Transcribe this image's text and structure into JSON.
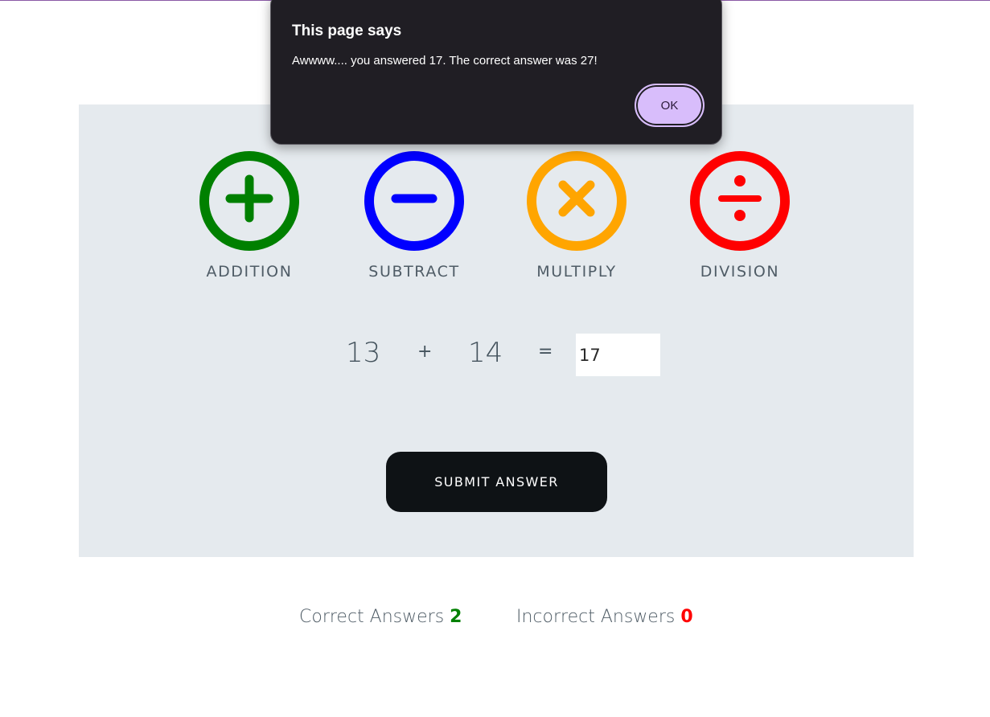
{
  "game": {
    "operations": [
      {
        "label": "ADDITION",
        "icon": "plus-circle-icon",
        "color": "#008000"
      },
      {
        "label": "SUBTRACT",
        "icon": "minus-circle-icon",
        "color": "#0000ff"
      },
      {
        "label": "MULTIPLY",
        "icon": "times-circle-icon",
        "color": "#ffa500"
      },
      {
        "label": "DIVISION",
        "icon": "divide-circle-icon",
        "color": "#ff0000"
      }
    ],
    "question": {
      "operand1": "13",
      "operator": "+",
      "operand2": "14",
      "equals": "=",
      "answer_value": "17"
    },
    "submit_label": "SUBMIT ANSWER"
  },
  "score": {
    "correct_label": "Correct Answers",
    "correct_value": "2",
    "correct_color": "#008000",
    "incorrect_label": "Incorrect Answers",
    "incorrect_value": "0",
    "incorrect_color": "#ff0000"
  },
  "dialog": {
    "title": "This page says",
    "message": "Awwww.... you answered 17. The correct answer was 27!",
    "ok_label": "OK",
    "accent": "#d8bdfb"
  }
}
